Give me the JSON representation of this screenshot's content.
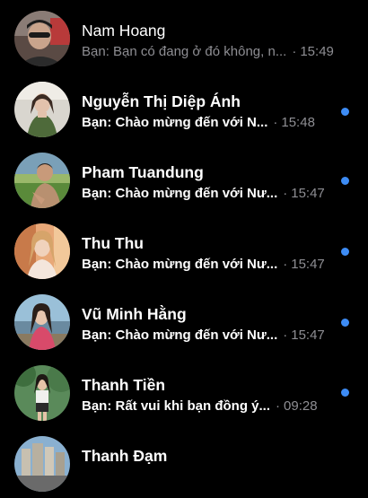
{
  "conversations": [
    {
      "name": "Nam Hoang",
      "preview": "Bạn: Bạn có đang ở đó không, n...",
      "separator": "·",
      "time": "15:49",
      "unread": false,
      "avatar": "avatar-photo-man-sunglasses"
    },
    {
      "name": "Nguyễn Thị Diệp Ánh",
      "preview": "Bạn: Chào mừng đến với N...",
      "separator": "·",
      "time": "15:48",
      "unread": true,
      "avatar": "avatar-photo-woman-green-dress"
    },
    {
      "name": "Pham Tuandung",
      "preview": "Bạn: Chào mừng đến với Nư...",
      "separator": "·",
      "time": "15:47",
      "unread": true,
      "avatar": "avatar-photo-man-outdoors"
    },
    {
      "name": "Thu Thu",
      "preview": "Bạn: Chào mừng đến với Nư...",
      "separator": "·",
      "time": "15:47",
      "unread": true,
      "avatar": "avatar-photo-woman-blonde"
    },
    {
      "name": "Vũ Minh Hằng",
      "preview": "Bạn: Chào mừng đến với Nư...",
      "separator": "·",
      "time": "15:47",
      "unread": true,
      "avatar": "avatar-photo-woman-seaside"
    },
    {
      "name": "Thanh Tiền",
      "preview": "Bạn: Rất vui khi bạn đồng ý...",
      "separator": "·",
      "time": "09:28",
      "unread": true,
      "avatar": "avatar-photo-woman-forest"
    },
    {
      "name": "Thanh Đạm",
      "preview": "",
      "separator": "",
      "time": "",
      "unread": false,
      "avatar": "avatar-photo-cityscape"
    }
  ],
  "colors": {
    "background": "#000000",
    "unread_dot": "#3d8cf5",
    "secondary_text": "#8e8e93",
    "primary_text": "#ffffff"
  }
}
